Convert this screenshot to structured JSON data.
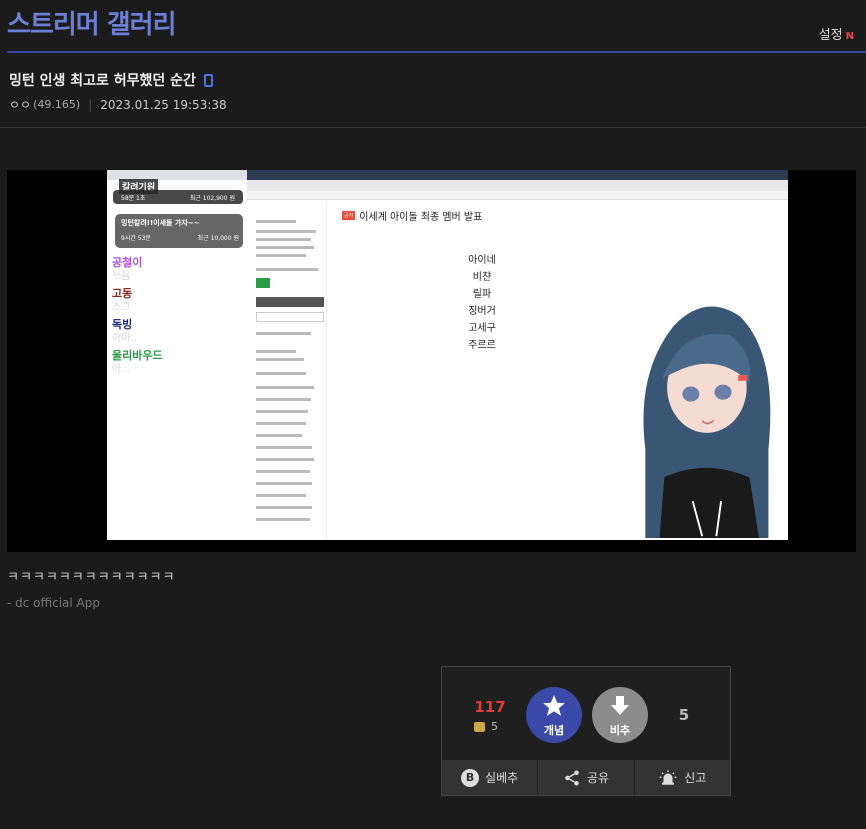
{
  "header": {
    "gallery_title": "스트리머 갤러리",
    "settings_label": "설정",
    "new_badge": "N"
  },
  "post": {
    "title": "밍턴 인생 최고로 허무했던 순간",
    "author": "ㅇㅇ",
    "author_ip": "(49.165)",
    "separator": "|",
    "date": "2023.01.25 19:53:38",
    "body_text": "ㅋㅋㅋㅋㅋㅋㅋㅋㅋㅋㅋㅋㅋ",
    "signature": "- dc official App"
  },
  "media": {
    "widget_title": "칼려기원",
    "widget_row_left": "58분 1초",
    "widget_row_right": "최근 102,900 원",
    "donation_title": "밍턴칼려!!이세돌 가자~~",
    "donation_left": "9시간 53분",
    "donation_right": "최근 10,000 원",
    "ranks": [
      {
        "label": "공철이",
        "sub": "쓰음",
        "color": "#b34fd6"
      },
      {
        "label": "고동",
        "sub": "스그",
        "color": "#8a2a1f"
      },
      {
        "label": "독빙",
        "sub": "하아..",
        "color": "#1c2c7a"
      },
      {
        "label": "울리바우드",
        "sub": "아...",
        "color": "#2a9d49"
      }
    ],
    "article_badge": "공지",
    "article_title": "이세계 아이돌 최종 멤버 발표",
    "members": [
      "아이네",
      "비챤",
      "릴파",
      "징버거",
      "고세구",
      "주르르"
    ]
  },
  "vote": {
    "up_count": "117",
    "fixed_count": "5",
    "up_label": "개념",
    "down_label": "비추",
    "down_count": "5",
    "actions": [
      {
        "label": "실베추",
        "icon": "B"
      },
      {
        "label": "공유",
        "icon": "share"
      },
      {
        "label": "신고",
        "icon": "siren"
      }
    ]
  },
  "colors": {
    "accent": "#3b4aa8",
    "title_blue": "#6b7fd6",
    "up_red": "#e03c3c"
  }
}
